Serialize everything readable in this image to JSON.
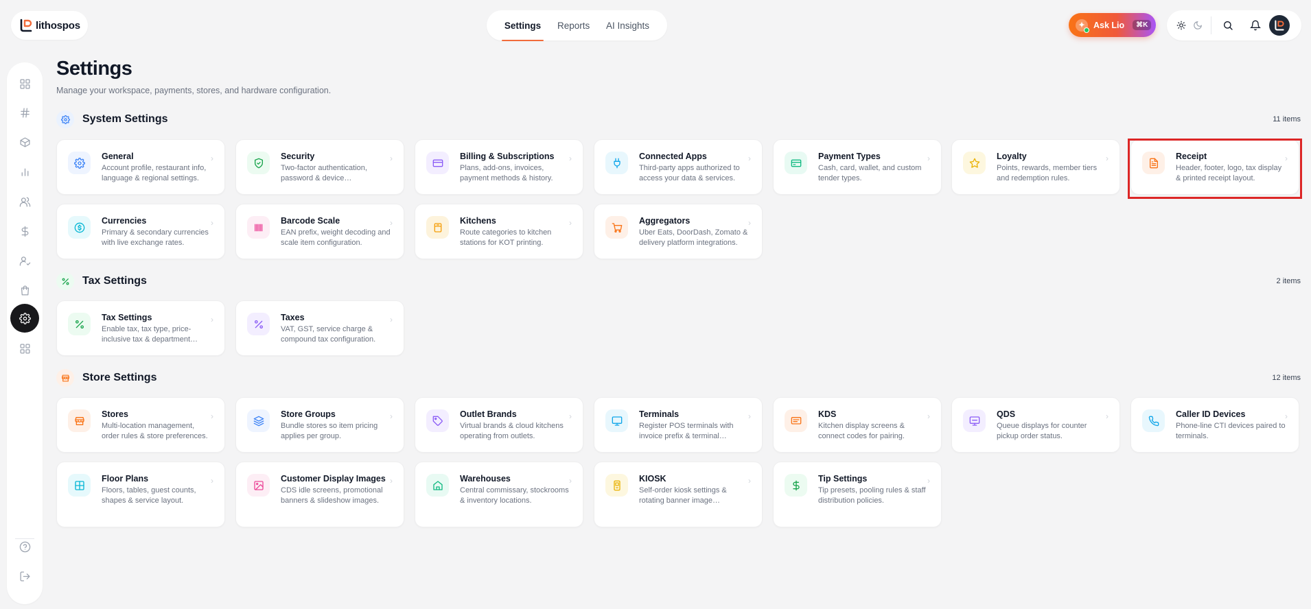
{
  "brand": {
    "name": "lithospos"
  },
  "topnav": {
    "tabs": [
      "Settings",
      "Reports",
      "AI Insights"
    ],
    "active": 0
  },
  "ask": {
    "label": "Ask Lio",
    "shortcut": "⌘K"
  },
  "page": {
    "title": "Settings",
    "subtitle": "Manage your workspace, payments, stores, and hardware configuration."
  },
  "sections": [
    {
      "title": "System Settings",
      "count": "11 items",
      "icon": "gear-icon",
      "color": "#3b82f6",
      "bg": "#eaf2fe",
      "cards": [
        {
          "title": "General",
          "desc": "Account profile, restaurant info, language & regional settings.",
          "icon": "gear-icon",
          "color": "#3b82f6",
          "bg": "#eef4ff"
        },
        {
          "title": "Security",
          "desc": "Two-factor authentication, password & device management.",
          "icon": "shield-icon",
          "color": "#16a34a",
          "bg": "#ecfbf1"
        },
        {
          "title": "Billing & Subscriptions",
          "desc": "Plans, add-ons, invoices, payment methods & history.",
          "icon": "card-icon",
          "color": "#8b5cf6",
          "bg": "#f3eeff"
        },
        {
          "title": "Connected Apps",
          "desc": "Third-party apps authorized to access your data & services.",
          "icon": "plug-icon",
          "color": "#0ea5e9",
          "bg": "#e8f7fd"
        },
        {
          "title": "Payment Types",
          "desc": "Cash, card, wallet, and custom tender types.",
          "icon": "wallet-icon",
          "color": "#10b981",
          "bg": "#e8faf3"
        },
        {
          "title": "Loyalty",
          "desc": "Points, rewards, member tiers and redemption rules.",
          "icon": "star-icon",
          "color": "#eab308",
          "bg": "#fdf7df"
        },
        {
          "title": "Receipt",
          "desc": "Header, footer, logo, tax display & printed receipt layout.",
          "icon": "receipt-icon",
          "color": "#f97316",
          "bg": "#fef0e7"
        },
        {
          "title": "Currencies",
          "desc": "Primary & secondary currencies with live exchange rates.",
          "icon": "currency-icon",
          "color": "#06b6d4",
          "bg": "#e6f9fc"
        },
        {
          "title": "Barcode Scale",
          "desc": "EAN prefix, weight decoding and scale item configuration.",
          "icon": "barcode-icon",
          "color": "#ec4899",
          "bg": "#fdeef5"
        },
        {
          "title": "Kitchens",
          "desc": "Route categories to kitchen stations for KOT printing.",
          "icon": "kitchen-icon",
          "color": "#f59e0b",
          "bg": "#fdf3dc"
        },
        {
          "title": "Aggregators",
          "desc": "Uber Eats, DoorDash, Zomato & delivery platform integrations.",
          "icon": "cart-icon",
          "color": "#f97316",
          "bg": "#fef0e7"
        }
      ]
    },
    {
      "title": "Tax Settings",
      "count": "2 items",
      "icon": "percent-icon",
      "color": "#16a34a",
      "bg": "#ecfbf1",
      "cards": [
        {
          "title": "Tax Settings",
          "desc": "Enable tax, tax type, price-inclusive tax & department mapping.",
          "icon": "percent-icon",
          "color": "#16a34a",
          "bg": "#ecfbf1"
        },
        {
          "title": "Taxes",
          "desc": "VAT, GST, service charge & compound tax configuration.",
          "icon": "percent-icon",
          "color": "#8b5cf6",
          "bg": "#f3eeff"
        }
      ]
    },
    {
      "title": "Store Settings",
      "count": "12 items",
      "icon": "store-icon",
      "color": "#f97316",
      "bg": "#fef0e7",
      "cards": [
        {
          "title": "Stores",
          "desc": "Multi-location management, order rules & store preferences.",
          "icon": "store-icon",
          "color": "#f97316",
          "bg": "#fef0e7"
        },
        {
          "title": "Store Groups",
          "desc": "Bundle stores so item pricing applies per group.",
          "icon": "layers-icon",
          "color": "#3b82f6",
          "bg": "#eef4ff"
        },
        {
          "title": "Outlet Brands",
          "desc": "Virtual brands & cloud kitchens operating from outlets.",
          "icon": "tag-icon",
          "color": "#8b5cf6",
          "bg": "#f3eeff"
        },
        {
          "title": "Terminals",
          "desc": "Register POS terminals with invoice prefix & terminal settings.",
          "icon": "monitor-icon",
          "color": "#0ea5e9",
          "bg": "#e8f7fd"
        },
        {
          "title": "KDS",
          "desc": "Kitchen display screens & connect codes for pairing.",
          "icon": "kds-icon",
          "color": "#f97316",
          "bg": "#fef0e7"
        },
        {
          "title": "QDS",
          "desc": "Queue displays for counter pickup order status.",
          "icon": "display-icon",
          "color": "#8b5cf6",
          "bg": "#f3eeff"
        },
        {
          "title": "Caller ID Devices",
          "desc": "Phone-line CTI devices paired to terminals.",
          "icon": "phone-icon",
          "color": "#0ea5e9",
          "bg": "#e8f7fd"
        },
        {
          "title": "Floor Plans",
          "desc": "Floors, tables, guest counts, shapes & service layout.",
          "icon": "grid-icon",
          "color": "#06b6d4",
          "bg": "#e6f9fc"
        },
        {
          "title": "Customer Display Images",
          "desc": "CDS idle screens, promotional banners & slideshow images.",
          "icon": "image-icon",
          "color": "#ec4899",
          "bg": "#fdeef5"
        },
        {
          "title": "Warehouses",
          "desc": "Central commissary, stockrooms & inventory locations.",
          "icon": "warehouse-icon",
          "color": "#10b981",
          "bg": "#e8faf3"
        },
        {
          "title": "KIOSK",
          "desc": "Self-order kiosk settings & rotating banner image configuration.",
          "icon": "kiosk-icon",
          "color": "#eab308",
          "bg": "#fdf7df"
        },
        {
          "title": "Tip Settings",
          "desc": "Tip presets, pooling rules & staff distribution policies.",
          "icon": "dollar-icon",
          "color": "#16a34a",
          "bg": "#ecfbf1"
        }
      ]
    }
  ],
  "sidebar": {
    "items": [
      "dashboard-icon",
      "hash-icon",
      "box-icon",
      "chart-icon",
      "users-icon",
      "dollar-icon",
      "user-check-icon",
      "bag-icon",
      "gear-icon",
      "apps-icon"
    ],
    "active": 8,
    "bottom": [
      "help-icon",
      "logout-icon"
    ]
  }
}
